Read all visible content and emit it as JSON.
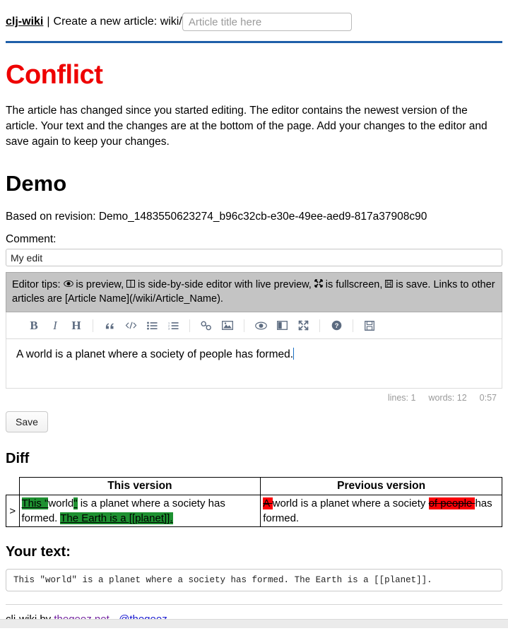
{
  "topbar": {
    "brand": "clj-wiki",
    "separator": "|",
    "label": "Create a new article: wiki/",
    "title_input_value": "",
    "title_input_placeholder": "Article title here"
  },
  "conflict": {
    "heading": "Conflict",
    "message": "The article has changed since you started editing. The editor contains the newest version of the article. Your text and the changes are at the bottom of the page. Add your changes to the editor and save again to keep your changes."
  },
  "article": {
    "title": "Demo",
    "revision_line": "Based on revision: Demo_1483550623274_b96c32cb-e30e-49ee-aed9-817a37908c90",
    "comment_label": "Comment:",
    "comment_value": "My edit",
    "comment_placeholder": ""
  },
  "editor": {
    "tips_prefix": "Editor tips:",
    "tips_parts": {
      "preview_icon": "◉",
      "preview_text": " is preview,",
      "sidebyside_icon": "◫",
      "sidebyside_text": " is side-by-side editor with live preview,",
      "fullscreen_icon": "⤢",
      "fullscreen_text": " is fullscreen,",
      "save_icon": "Ὃe",
      "save_text": " is save. Links to other articles are [Article Name](/wiki/Article_Name)."
    },
    "tips_full": "Editor tips: ◉ is preview, ◫ is side-by-side editor with live preview, ⤢ is fullscreen, 🖫 is save. Links to other articles are [Article Name](/wiki/Article_Name).",
    "toolbar": [
      {
        "name": "bold-icon",
        "glyph": "B",
        "title": "Bold"
      },
      {
        "name": "italic-icon",
        "glyph": "I",
        "title": "Italic"
      },
      {
        "name": "heading-icon",
        "glyph": "H",
        "title": "Heading"
      },
      {
        "name": "quote-icon",
        "glyph": "“",
        "title": "Quote"
      },
      {
        "name": "code-icon",
        "glyph": "</>",
        "title": "Code"
      },
      {
        "name": "unordered-list-icon",
        "glyph": "≡",
        "title": "Generic List"
      },
      {
        "name": "ordered-list-icon",
        "glyph": "≡",
        "title": "Numbered List"
      },
      {
        "name": "link-icon",
        "glyph": "⚭",
        "title": "Create Link"
      },
      {
        "name": "image-icon",
        "glyph": "Ὓc",
        "title": "Insert Image"
      },
      {
        "name": "preview-icon",
        "glyph": "◉",
        "title": "Toggle Preview"
      },
      {
        "name": "side-by-side-icon",
        "glyph": "◫",
        "title": "Toggle Side by Side"
      },
      {
        "name": "fullscreen-icon",
        "glyph": "⤢",
        "title": "Toggle Fullscreen"
      },
      {
        "name": "guide-icon",
        "glyph": "?",
        "title": "Markdown Guide"
      },
      {
        "name": "save-icon",
        "glyph": "὚b",
        "title": "Save"
      }
    ],
    "content": "A world is a planet where a society of people has formed.",
    "status": {
      "lines_label": "lines: 1",
      "words_label": "words: 12",
      "time_label": "0:57"
    },
    "save_button": "Save"
  },
  "diff": {
    "heading": "Diff",
    "columns": [
      "",
      "This version",
      "Previous version"
    ],
    "rows": [
      {
        "marker": ">",
        "this_version": [
          {
            "text": "This \"",
            "type": "add"
          },
          {
            "text": "world",
            "type": "same"
          },
          {
            "text": "\"",
            "type": "add"
          },
          {
            "text": " is a planet where a society has formed. ",
            "type": "same"
          },
          {
            "text": "The Earth is a [[planet]].",
            "type": "add"
          }
        ],
        "previous_version": [
          {
            "text": "A ",
            "type": "remove"
          },
          {
            "text": "world is a planet where a society ",
            "type": "same"
          },
          {
            "text": "of people ",
            "type": "remove"
          },
          {
            "text": "has formed.",
            "type": "same"
          }
        ]
      }
    ]
  },
  "your_text": {
    "heading": "Your text:",
    "content": "This \"world\" is a planet where a society has formed. The Earth is a [[planet]]."
  },
  "footer": {
    "prefix": "clj-wiki by ",
    "link1": "thegeez.net",
    "middle": " - ",
    "link2": "@thegeez"
  },
  "colors": {
    "conflict_red": "#ee0000",
    "rule_blue": "#1f5fa9",
    "diff_add_green": "#1e9131",
    "diff_remove_red": "#fb0007",
    "tips_bg": "#c4c4c4",
    "toolbar_icon": "#5c6b80"
  }
}
